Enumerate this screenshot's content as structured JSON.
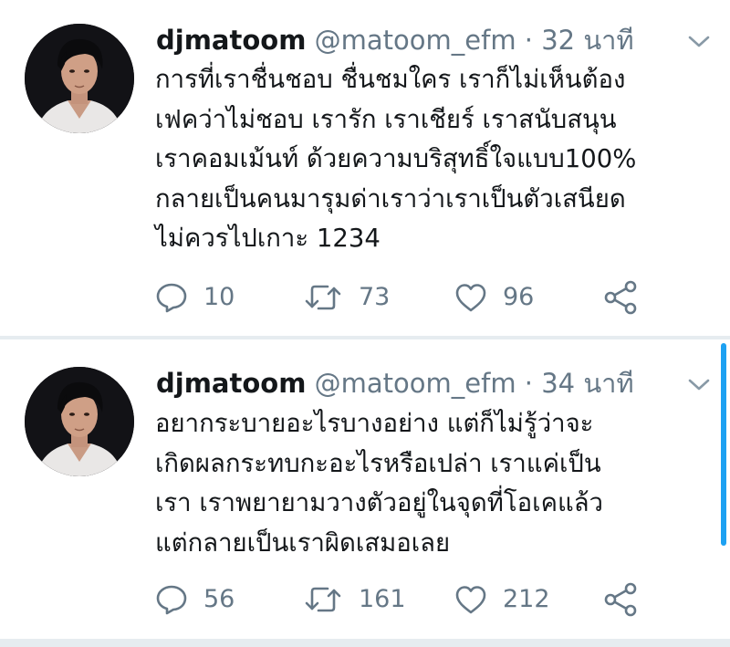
{
  "tweets": [
    {
      "display_name": "djmatoom",
      "handle": "@matoom_efm",
      "separator": "·",
      "time": "32 นาที",
      "text_lines": [
        "การที่เราชื่นชอบ ชื่นชมใคร เราก็ไม่เห็นต้อง",
        "เฟคว่าไม่ชอบ เรารัก เราเชียร์ เราสนับสนุน",
        "เราคอมเม้นท์ ด้วยความบริสุทธิ์ใจแบบ100%",
        "กลายเป็นคนมารุมด่าเราว่าเราเป็นตัวเสนียด",
        "ไม่ควรไปเกาะ 1234"
      ],
      "reply_count": "10",
      "retweet_count": "73",
      "like_count": "96"
    },
    {
      "display_name": "djmatoom",
      "handle": "@matoom_efm",
      "separator": "·",
      "time": "34 นาที",
      "text_lines": [
        "อยากระบายอะไรบางอย่าง แต่ก็ไม่รู้ว่าจะ",
        "เกิดผลกระทบกะอะไรหรือเปล่า เราแค่เป็น",
        "เรา เราพยายามวางตัวอยู่ในจุดที่โอเคแล้ว",
        "แต่กลายเป็นเราผิดเสมอเลย"
      ],
      "reply_count": "56",
      "retweet_count": "161",
      "like_count": "212"
    }
  ],
  "icons": {
    "menu": "chevron-down-icon",
    "reply": "reply-icon",
    "retweet": "retweet-icon",
    "like": "heart-icon",
    "share": "share-icon"
  },
  "colors": {
    "text_primary": "#14171a",
    "text_secondary": "#657786",
    "divider": "#e6ecf0",
    "thread_accent": "#1da1f2"
  }
}
